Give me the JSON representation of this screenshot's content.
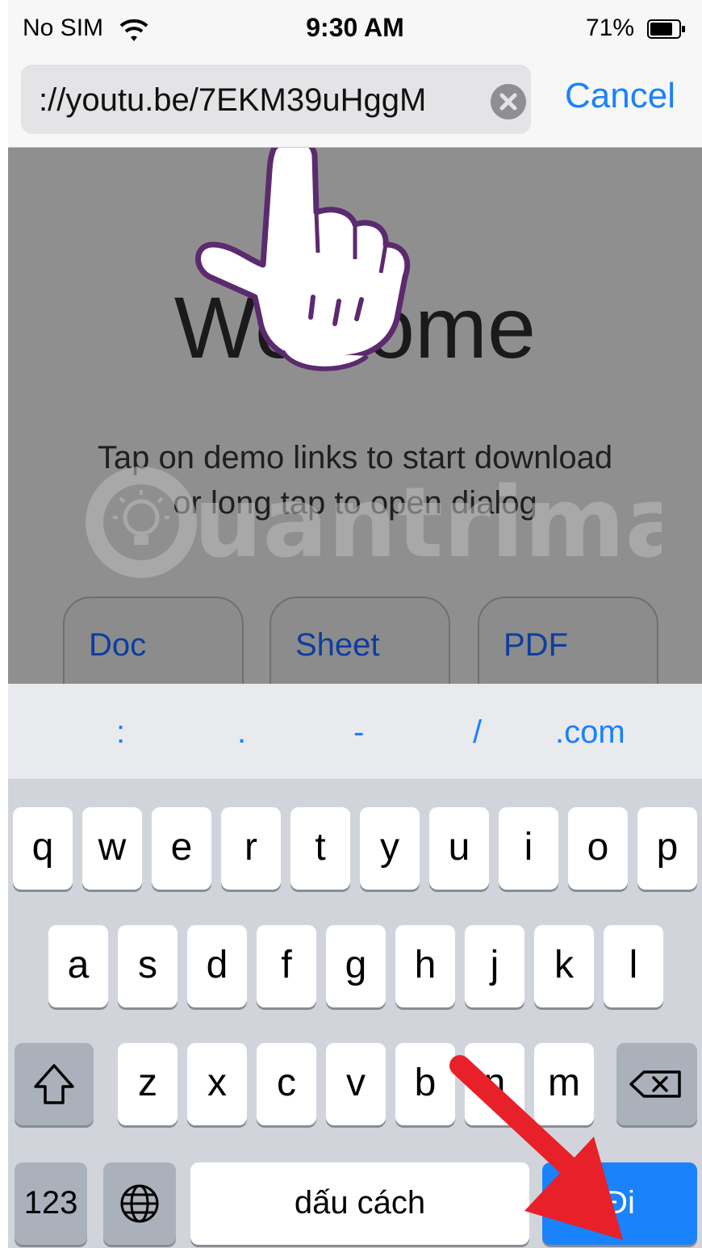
{
  "status_bar": {
    "carrier": "No SIM",
    "time": "9:30 AM",
    "battery": "71%"
  },
  "url_bar": {
    "value": "://youtu.be/7EKM39uHggM",
    "cancel_label": "Cancel"
  },
  "page": {
    "heading": "Welcome",
    "instruction_line1": "Tap on demo links to start download",
    "instruction_line2": "or long tap to open dialog",
    "buttons": [
      "Doc",
      "Sheet",
      "PDF"
    ],
    "watermark": "Quantrimang"
  },
  "suggestions": [
    ":",
    ".",
    "-",
    "/",
    ".com"
  ],
  "keyboard": {
    "row1": [
      "q",
      "w",
      "e",
      "r",
      "t",
      "y",
      "u",
      "i",
      "o",
      "p"
    ],
    "row2": [
      "a",
      "s",
      "d",
      "f",
      "g",
      "h",
      "j",
      "k",
      "l"
    ],
    "row3": [
      "z",
      "x",
      "c",
      "v",
      "b",
      "n",
      "m"
    ],
    "numbers_label": "123",
    "space_label": "dấu cách",
    "go_label": "Đi"
  },
  "colors": {
    "accent": "#1a82fb",
    "annotation_arrow": "#e8202a",
    "hand_outline": "#5c2a6e"
  },
  "icons": [
    "wifi-icon",
    "battery-icon",
    "clear-icon",
    "shift-icon",
    "backspace-icon",
    "globe-icon",
    "pointing-hand-icon",
    "lightbulb-icon"
  ]
}
